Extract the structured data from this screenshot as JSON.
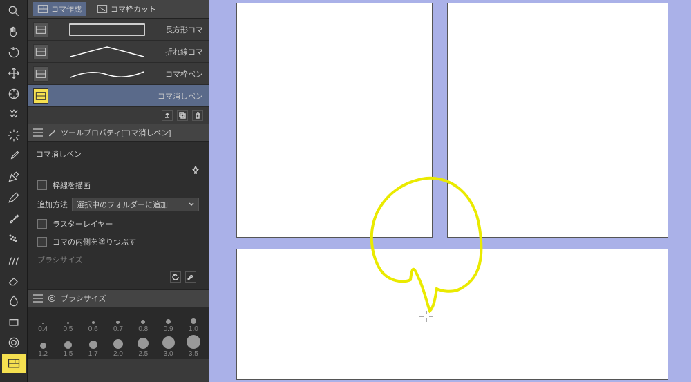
{
  "subtool_header": {
    "koma_create": "コマ作成",
    "koma_cut": "コマ枠カット"
  },
  "subtools": [
    {
      "label": "長方形コマ",
      "name": "rectangle-frame"
    },
    {
      "label": "折れ線コマ",
      "name": "polyline-frame"
    },
    {
      "label": "コマ枠ペン",
      "name": "frame-border-pen"
    },
    {
      "label": "コマ消しペン",
      "name": "frame-eraser-pen"
    }
  ],
  "tool_property": {
    "header": "ツールプロパティ[コマ消しペン]",
    "title": "コマ消しペン",
    "draw_border": "枠線を描画",
    "add_method_label": "追加方法",
    "add_method_value": "選択中のフォルダーに追加",
    "raster_layer": "ラスターレイヤー",
    "fill_inside": "コマの内側を塗りつぶす",
    "brush_size_cut": "ブラシサイズ"
  },
  "brush_panel": {
    "header": "ブラシサイズ",
    "sizes_row1": [
      "0.4",
      "0.5",
      "0.6",
      "0.7",
      "0.8",
      "0.9",
      "1.0"
    ],
    "sizes_row2": [
      "1.2",
      "1.5",
      "1.7",
      "2.0",
      "2.5",
      "3.0",
      "3.5"
    ]
  }
}
